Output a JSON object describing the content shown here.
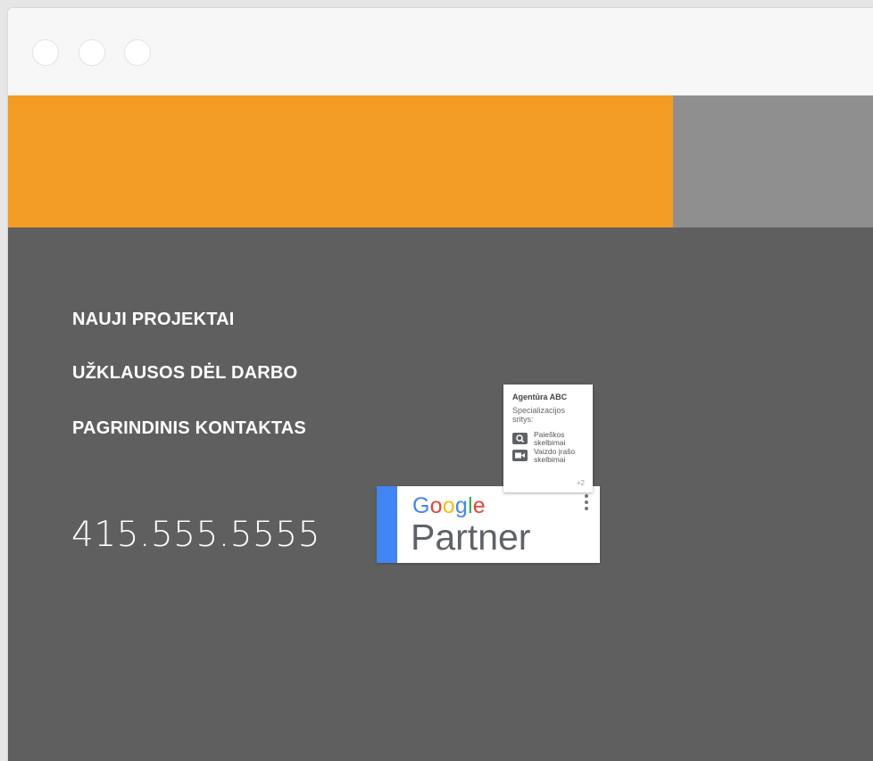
{
  "window": {
    "controls": [
      "close",
      "minimize",
      "maximize"
    ]
  },
  "banner": {
    "colors": {
      "orange": "#f39c25",
      "gray": "#8f8f8f"
    }
  },
  "footer": {
    "background": "#5f5f5f",
    "nav": [
      {
        "label": "NAUJI PROJEKTAI"
      },
      {
        "label": "UŽKLAUSOS DĖL DARBO"
      },
      {
        "label": "PAGRINDINIS KONTAKTAS"
      }
    ],
    "phone": "415.555.5555"
  },
  "google_partner": {
    "google_letters": [
      {
        "ch": "G",
        "color": "#4285f4"
      },
      {
        "ch": "o",
        "color": "#ea4335"
      },
      {
        "ch": "o",
        "color": "#fbbc05"
      },
      {
        "ch": "g",
        "color": "#4285f4"
      },
      {
        "ch": "l",
        "color": "#34a853"
      },
      {
        "ch": "e",
        "color": "#ea4335"
      }
    ],
    "partner_label": "Partner",
    "menu_icon": "more-vert-icon",
    "card": {
      "title": "Agentūra ABC",
      "subtitle": "Specializacijos sritys:",
      "items": [
        {
          "icon": "search-icon",
          "label": "Paieškos skelbimai"
        },
        {
          "icon": "video-icon",
          "label": "Vaizdo įrašo skelbimai"
        }
      ],
      "more": "+2"
    }
  }
}
